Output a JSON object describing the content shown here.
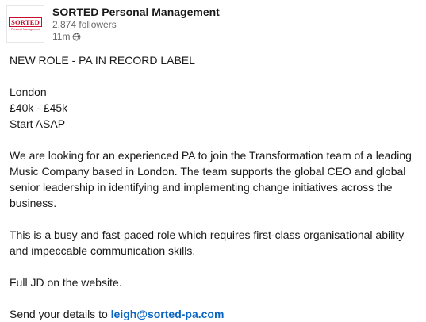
{
  "post": {
    "company_logo": {
      "word": "SORTED",
      "tagline": "Personal Management",
      "brand_color": "#c8102e"
    },
    "company_name": "SORTED Personal Management",
    "followers": "2,874 followers",
    "time": "11m",
    "icons": {
      "visibility": "globe-icon"
    },
    "body": {
      "title": "NEW ROLE - PA IN RECORD LABEL",
      "location": "London",
      "salary": "£40k - £45k",
      "start": "Start ASAP",
      "paragraph_1": "We are looking for an experienced PA to join the Transformation team of a leading Music Company based in London. The team supports the global CEO and global senior leadership in identifying and implementing change initiatives across the business.",
      "paragraph_2": "This is a busy and fast-paced role which requires first-class organisational ability and impeccable communication skills.",
      "paragraph_3": "Full JD on the website.",
      "send_prefix": "Send your details to ",
      "email": "leigh@sorted-pa.com"
    },
    "colors": {
      "link": "#0a66c2",
      "secondary_text": "rgba(0,0,0,0.6)"
    }
  }
}
